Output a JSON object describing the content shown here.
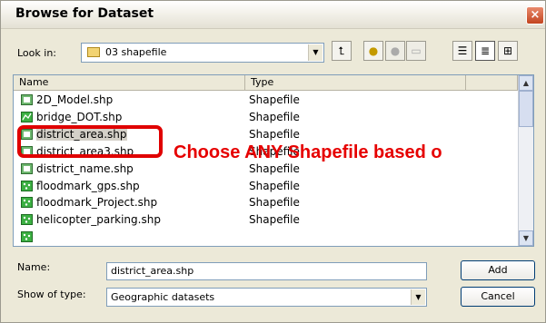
{
  "window": {
    "title": "Browse for Dataset",
    "close_glyph": "×"
  },
  "lookin": {
    "label": "Look in:",
    "value": "03 shapefile"
  },
  "toolbar": {
    "icons": [
      "up-one-level-icon",
      "connect-folder-icon",
      "disconnect-folder-icon",
      "new-folder-icon",
      "list-view-icon",
      "details-view-icon",
      "thumbnails-view-icon"
    ]
  },
  "columns": {
    "name": "Name",
    "type": "Type"
  },
  "files": [
    {
      "name": "2D_Model.shp",
      "type": "Shapefile",
      "icon": "polygon-shapefile-icon"
    },
    {
      "name": "bridge_DOT.shp",
      "type": "Shapefile",
      "icon": "line-shapefile-icon"
    },
    {
      "name": "district_area.shp",
      "type": "Shapefile",
      "icon": "polygon-shapefile-icon"
    },
    {
      "name": "district_area3.shp",
      "type": "Shapefile",
      "icon": "polygon-shapefile-icon"
    },
    {
      "name": "district_name.shp",
      "type": "Shapefile",
      "icon": "polygon-shapefile-icon"
    },
    {
      "name": "floodmark_gps.shp",
      "type": "Shapefile",
      "icon": "point-shapefile-icon"
    },
    {
      "name": "floodmark_Project.shp",
      "type": "Shapefile",
      "icon": "point-shapefile-icon"
    },
    {
      "name": "helicopter_parking.shp",
      "type": "Shapefile",
      "icon": "point-shapefile-icon"
    },
    {
      "name": "",
      "type": "",
      "icon": "point-shapefile-icon"
    }
  ],
  "selected_index": 2,
  "annotation": {
    "text": "Choose ANY Shapefile based o",
    "color": "#E60000"
  },
  "name_field": {
    "label": "Name:",
    "value": "district_area.shp"
  },
  "type_field": {
    "label": "Show of type:",
    "value": "Geographic datasets"
  },
  "buttons": {
    "add": "Add",
    "cancel": "Cancel"
  }
}
